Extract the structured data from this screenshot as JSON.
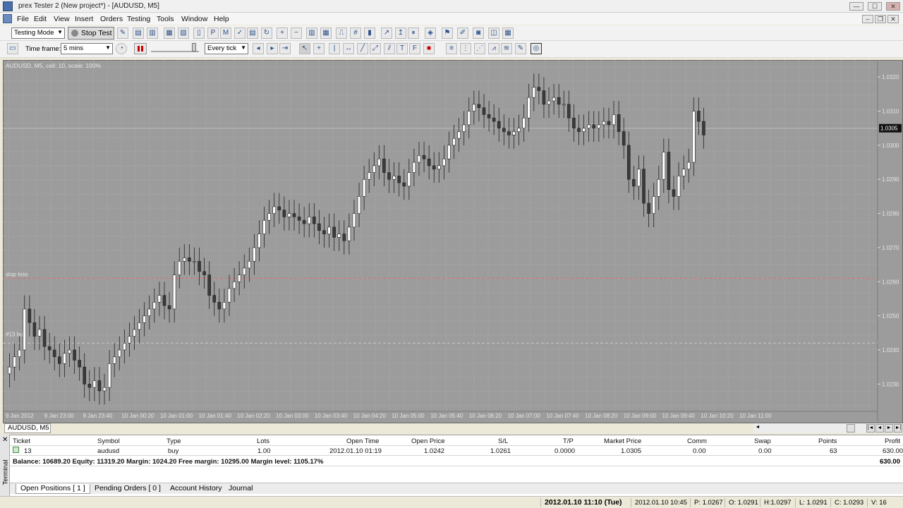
{
  "window": {
    "title": "prex Tester 2  (New project*) - [AUDUSD, M5]",
    "btn_min": "—",
    "btn_max": "☐",
    "btn_close": "✕",
    "doc_min": "–",
    "doc_restore": "❐",
    "doc_close": "✕"
  },
  "menu": [
    "File",
    "Edit",
    "View",
    "Insert",
    "Orders",
    "Testing",
    "Tools",
    "Window",
    "Help"
  ],
  "toolbar": {
    "mode_value": "Testing Mode",
    "stop_test_label": "Stop Test",
    "timeframe_label": "Time frame:",
    "timeframe_value": "5 mins",
    "speed_mode_value": "Every tick"
  },
  "chart": {
    "caption": "AUDUSD, M5, cell: 10, scale: 100%",
    "stop_loss_label": "stop loss",
    "order_label": "#13 buy",
    "current_price": "1.0305",
    "price_labels": [
      "1.0320",
      "1.0310",
      "1.0300",
      "1.0290",
      "1.0280",
      "1.0270",
      "1.0260",
      "1.0250",
      "1.0240",
      "1.0230"
    ],
    "time_labels": [
      "9 Jan 2012",
      "9 Jan 23:00",
      "9 Jan 23:40",
      "10 Jan 00:20",
      "10 Jan 01:00",
      "10 Jan 01:40",
      "10 Jan 02:20",
      "10 Jan 03:00",
      "10 Jan 03:40",
      "10 Jan 04:20",
      "10 Jan 05:00",
      "10 Jan 05:40",
      "10 Jan 06:20",
      "10 Jan 07:00",
      "10 Jan 07:40",
      "10 Jan 08:20",
      "10 Jan 09:00",
      "10 Jan 09:40",
      "10 Jan 10:20",
      "10 Jan 11:00"
    ],
    "tab_label": "AUDUSD, M5",
    "colors": {
      "background": "#9c9c9c",
      "grid": "#b2b2b2",
      "bull": "#ffffff",
      "bear": "#3a3a3a",
      "stop_line": "#e06a6a"
    }
  },
  "chart_data": {
    "type": "candlestick",
    "ylim": [
      1.0222,
      1.0325
    ],
    "stop_loss": 1.0261,
    "order_price": 1.0242,
    "current": 1.0305,
    "closes": [
      1.0235,
      1.0238,
      1.024,
      1.0252,
      1.0248,
      1.0244,
      1.0246,
      1.0241,
      1.024,
      1.0238,
      1.0236,
      1.0239,
      1.024,
      1.0237,
      1.0235,
      1.023,
      1.0229,
      1.0231,
      1.0228,
      1.0229,
      1.0236,
      1.0238,
      1.024,
      1.0242,
      1.0244,
      1.0246,
      1.0248,
      1.025,
      1.0252,
      1.0254,
      1.0256,
      1.0253,
      1.0252,
      1.0262,
      1.0266,
      1.0267,
      1.0266,
      1.0266,
      1.0263,
      1.0262,
      1.0256,
      1.0254,
      1.0252,
      1.0254,
      1.0258,
      1.026,
      1.0262,
      1.0264,
      1.0266,
      1.027,
      1.0274,
      1.0278,
      1.028,
      1.0282,
      1.0281,
      1.0279,
      1.028,
      1.0279,
      1.0278,
      1.0277,
      1.0279,
      1.0277,
      1.0275,
      1.0274,
      1.0276,
      1.0273,
      1.0274,
      1.0272,
      1.0276,
      1.028,
      1.0285,
      1.029,
      1.0292,
      1.0294,
      1.0296,
      1.0292,
      1.029,
      1.0291,
      1.0289,
      1.0288,
      1.0292,
      1.0295,
      1.0297,
      1.0296,
      1.0294,
      1.0293,
      1.0294,
      1.0296,
      1.03,
      1.0302,
      1.0304,
      1.0306,
      1.031,
      1.0312,
      1.0311,
      1.0309,
      1.0308,
      1.0307,
      1.0305,
      1.0304,
      1.0303,
      1.0304,
      1.0305,
      1.0308,
      1.0314,
      1.0317,
      1.0316,
      1.0312,
      1.0313,
      1.0314,
      1.0312,
      1.0312,
      1.0308,
      1.0305,
      1.0304,
      1.0305,
      1.0306,
      1.0305,
      1.0306,
      1.0307,
      1.0306,
      1.0309,
      1.0304,
      1.03,
      1.029,
      1.0288,
      1.0293,
      1.0283,
      1.028,
      1.0285,
      1.029,
      1.0298,
      1.0287,
      1.0285,
      1.0291,
      1.0293,
      1.0295,
      1.031,
      1.0307,
      1.0303
    ]
  },
  "bottom_nav": {
    "prev": "◄",
    "first": "|◄",
    "back": "◄",
    "fwd": "►",
    "last": "►|"
  },
  "terminal": {
    "side_label": "Terminal",
    "close_label": "✕",
    "headers": [
      "Ticket",
      "Symbol",
      "Type",
      "Lots",
      "Open Time",
      "Open Price",
      "S/L",
      "T/P",
      "Market Price",
      "Comm",
      "Swap",
      "Points",
      "Profit"
    ],
    "row": [
      "13",
      "audusd",
      "buy",
      "1.00",
      "2012.01.10 01:19",
      "1.0242",
      "1.0261",
      "0.0000",
      "1.0305",
      "0.00",
      "0.00",
      "63",
      "630.00"
    ],
    "balance_line": "Balance: 10689.20 Equity: 11319.20 Margin: 1024.20 Free margin: 10295.00 Margin level: 1105.17%",
    "total": "630.00",
    "tabs": [
      "Open Positions  [ 1 ]",
      "Pending Orders  [ 0 ]",
      "Account History",
      "Journal"
    ]
  },
  "status": {
    "current_time": "2012.01.10 11:10 (Tue)",
    "bar_time": "2012.01.10 10:45",
    "p": "P: 1.0267",
    "o": "O: 1.0291",
    "h": "H:1.0297",
    "l": "L: 1.0291",
    "c": "C: 1.0293",
    "v": "V: 16"
  }
}
